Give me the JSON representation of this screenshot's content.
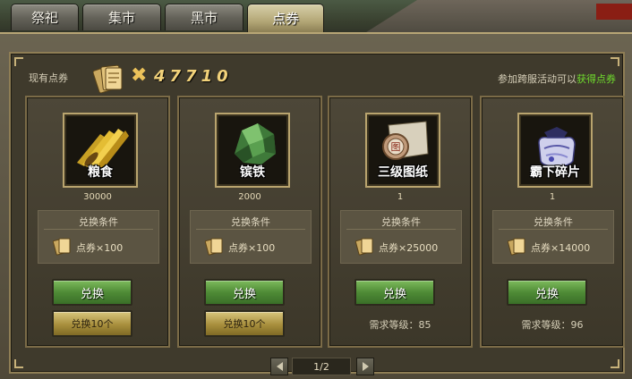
{
  "tabs": [
    {
      "label": "祭祀",
      "active": false
    },
    {
      "label": "集市",
      "active": false
    },
    {
      "label": "黑市",
      "active": false
    },
    {
      "label": "点券",
      "active": true
    }
  ],
  "header": {
    "balance_label": "现有点券",
    "balance_times": "✖",
    "balance_value": "47710",
    "hint_prefix": "参加跨服活动可以",
    "hint_link": "获得点券"
  },
  "cards": [
    {
      "icon": "grain-icon",
      "name": "粮食",
      "quantity": "30000",
      "cond_title": "兑换条件",
      "cost": "点券×100",
      "exchange_label": "兑换",
      "exchange10_label": "兑换10个",
      "requirement": ""
    },
    {
      "icon": "iron-ore-icon",
      "name": "镔铁",
      "quantity": "2000",
      "cond_title": "兑换条件",
      "cost": "点券×100",
      "exchange_label": "兑换",
      "exchange10_label": "兑换10个",
      "requirement": ""
    },
    {
      "icon": "blueprint-scroll-icon",
      "name": "三级图纸",
      "quantity": "1",
      "cond_title": "兑换条件",
      "cost": "点券×25000",
      "exchange_label": "兑换",
      "exchange10_label": "",
      "requirement": "需求等级：85"
    },
    {
      "icon": "fragment-bag-icon",
      "name": "霸下碎片",
      "quantity": "1",
      "cond_title": "兑换条件",
      "cost": "点券×14000",
      "exchange_label": "兑换",
      "exchange10_label": "",
      "requirement": "需求等级：96"
    }
  ],
  "pager": {
    "text": "1/2"
  },
  "colors": {
    "hint_link": "#6fdc2d",
    "balance": "#f2d27a",
    "green_button": "#4f8b36",
    "gold_button": "#a88f3d"
  }
}
